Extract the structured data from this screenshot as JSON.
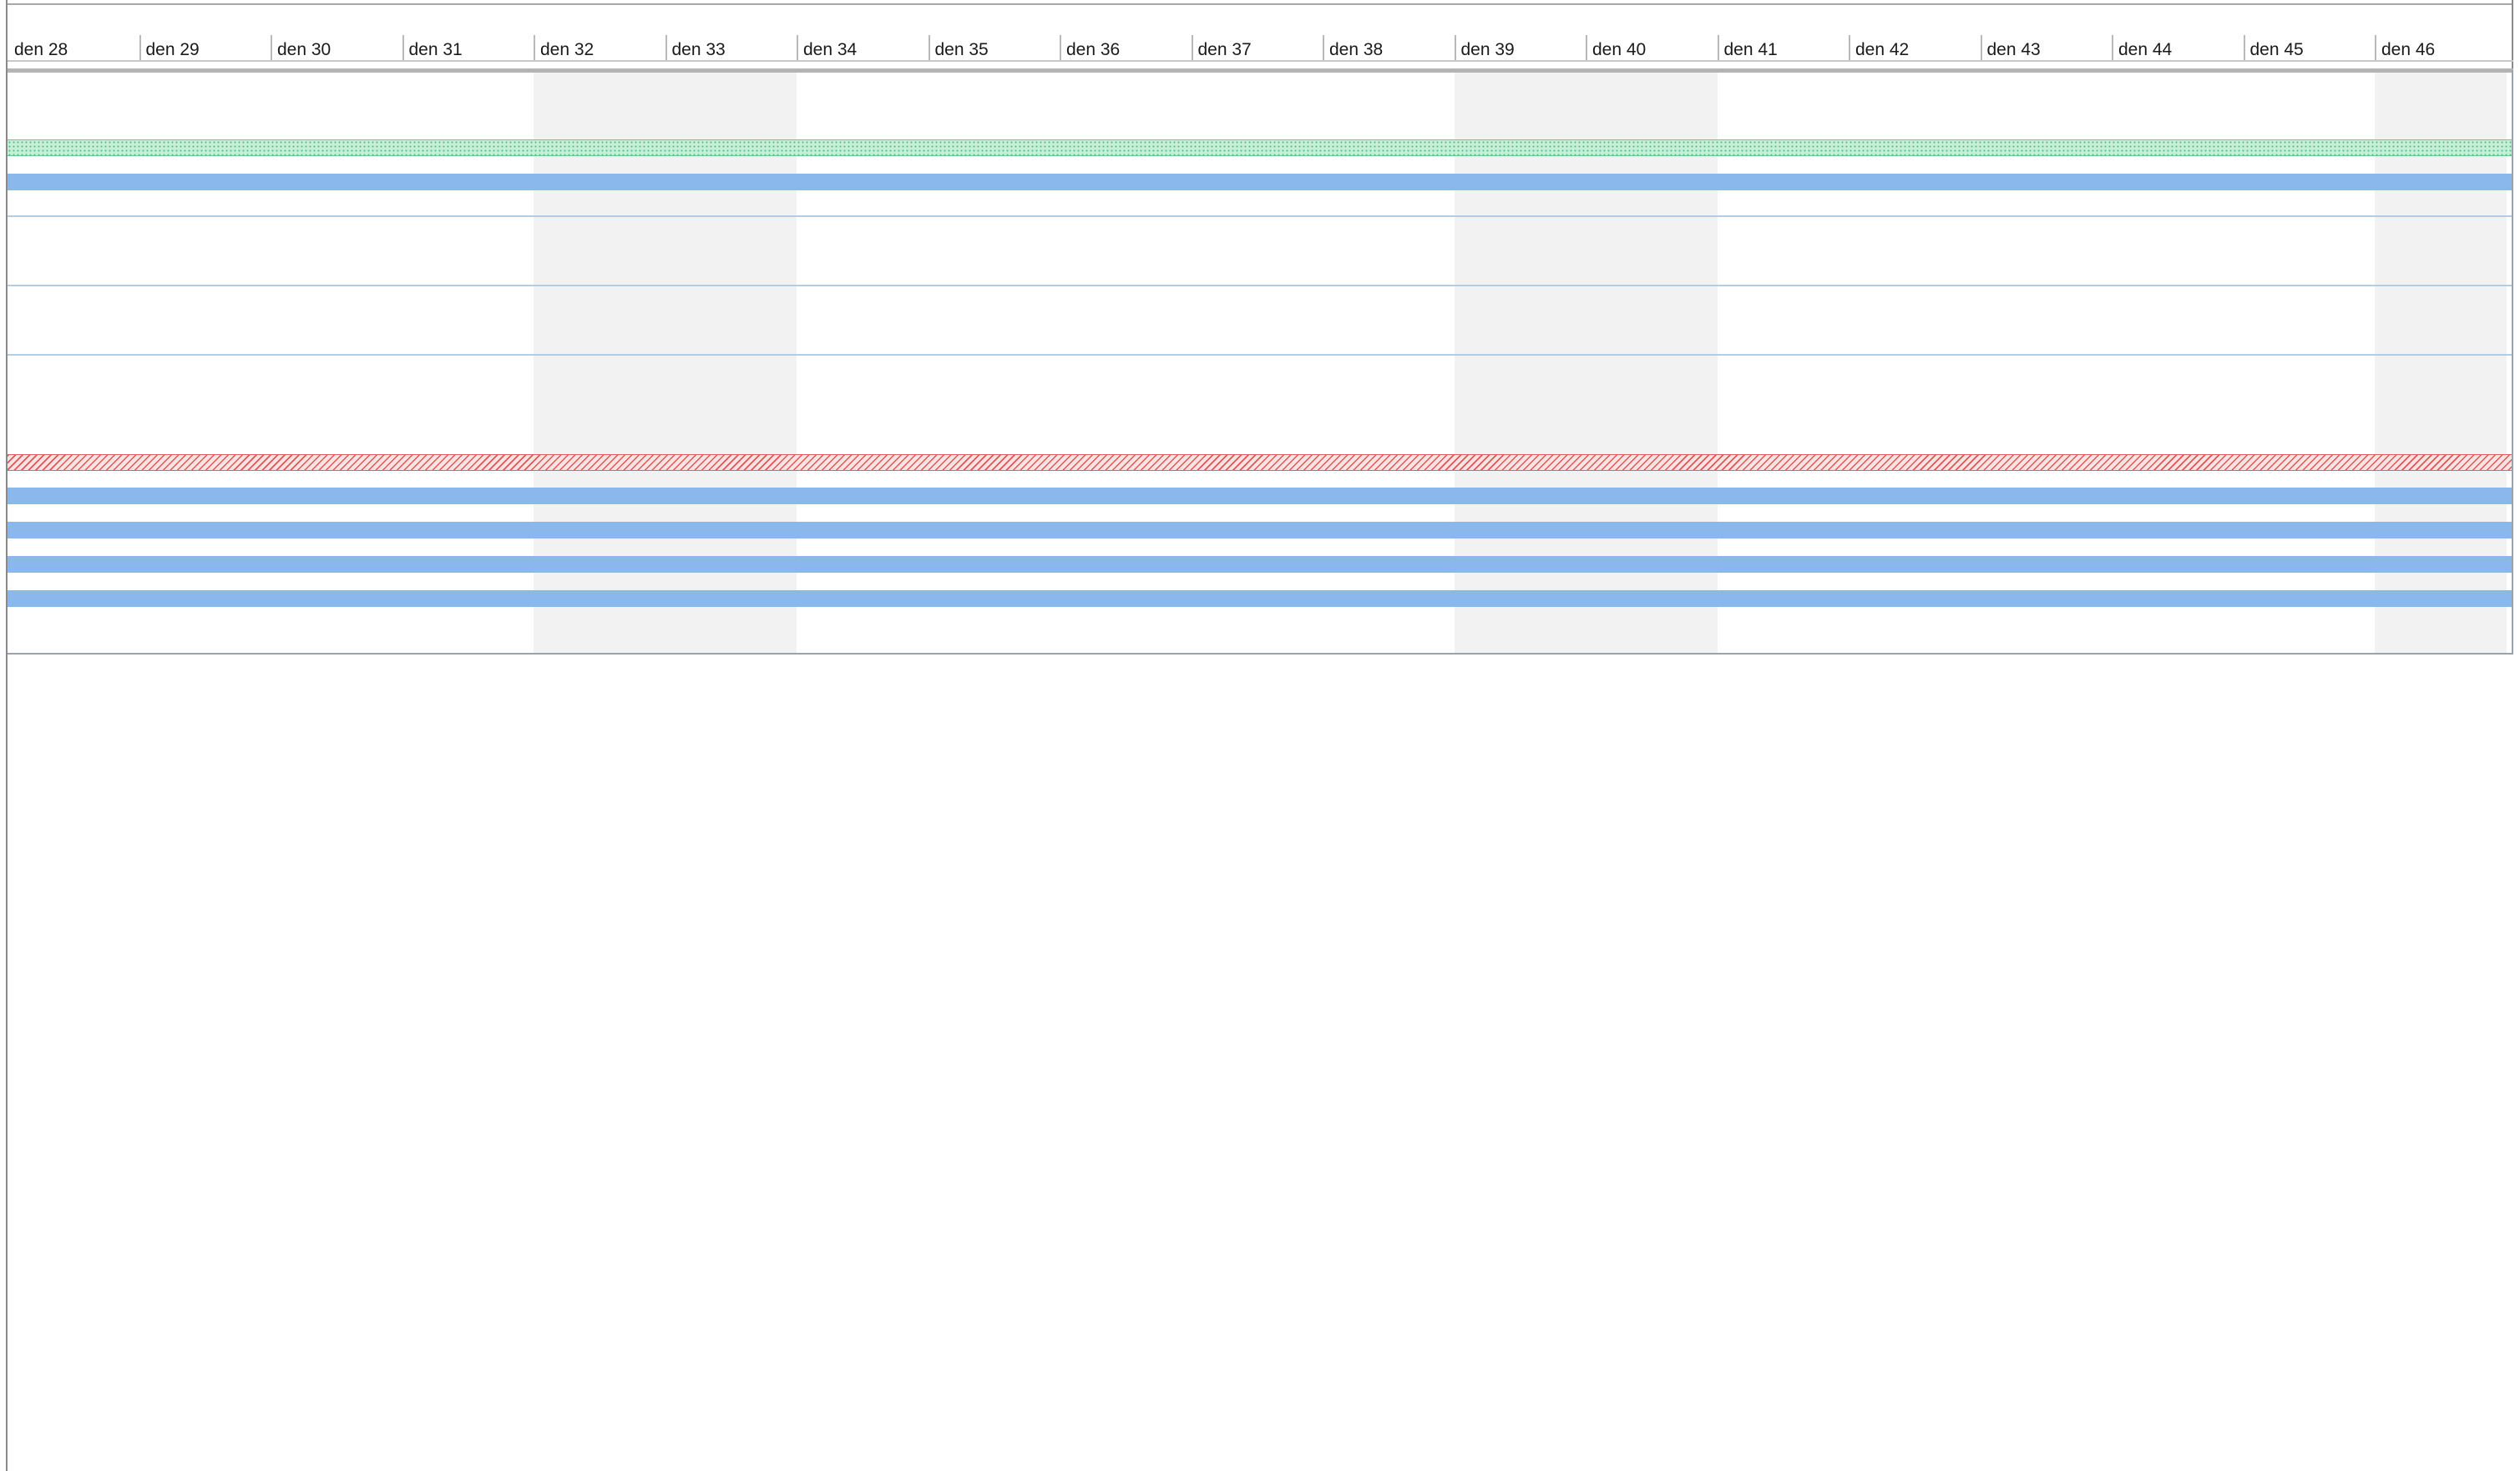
{
  "timeline": {
    "days": [
      "den 28",
      "den 29",
      "den 30",
      "den 31",
      "den 32",
      "den 33",
      "den 34",
      "den 35",
      "den 36",
      "den 37",
      "den 38",
      "den 39",
      "den 40",
      "den 41",
      "den 42",
      "den 43",
      "den 44",
      "den 45",
      "den 46"
    ],
    "shaded_days": [
      "den 32",
      "den 33",
      "den 39",
      "den 40",
      "den 46"
    ]
  },
  "rows": [
    {
      "type": "green-hatched"
    },
    {
      "type": "blue"
    },
    {
      "type": "divider"
    },
    {
      "type": "divider"
    },
    {
      "type": "divider"
    },
    {
      "type": "red-hatched"
    },
    {
      "type": "blue"
    },
    {
      "type": "blue"
    },
    {
      "type": "blue"
    },
    {
      "type": "blue"
    }
  ],
  "colors": {
    "blue_bar": "#8ab8ec",
    "green_bar": "#4fbf83",
    "red_bar": "#e05555",
    "row_divider": "#b3cde3",
    "shaded_column": "#f2f2f2"
  }
}
